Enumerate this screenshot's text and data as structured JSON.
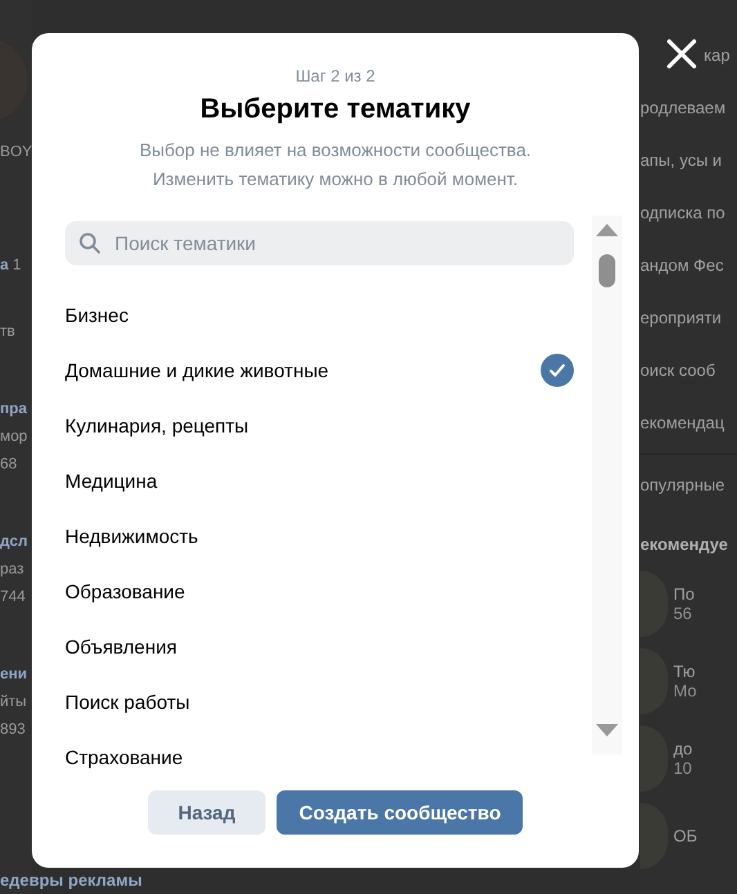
{
  "background": {
    "left_items": [
      {
        "kind": "avatar"
      },
      {
        "kind": "text",
        "text": "BOY"
      },
      {
        "kind": "link",
        "text": "а",
        "count": "1"
      },
      {
        "kind": "text",
        "text": "тв"
      },
      {
        "kind": "heading",
        "text": "пра"
      },
      {
        "kind": "text",
        "text": "мор"
      },
      {
        "kind": "text",
        "text": "68"
      },
      {
        "kind": "heading",
        "text": "дсл"
      },
      {
        "kind": "text",
        "text": "раз"
      },
      {
        "kind": "text",
        "text": "744"
      },
      {
        "kind": "heading",
        "text": "ени"
      },
      {
        "kind": "text",
        "text": "йты"
      },
      {
        "kind": "text",
        "text": "893"
      }
    ],
    "bottom_heading": "едевры рекламы",
    "menu": [
      {
        "kind": "after_close",
        "text": "кар"
      },
      {
        "kind": "item",
        "text": "родлеваем"
      },
      {
        "kind": "item",
        "text": "апы, усы и"
      },
      {
        "kind": "item",
        "text": "одписка по"
      },
      {
        "kind": "item",
        "text": "андом Фес"
      },
      {
        "kind": "item",
        "text": "ероприяти"
      },
      {
        "kind": "item",
        "text": "оиск сооб"
      },
      {
        "kind": "item",
        "text": "екомендац"
      },
      {
        "kind": "divided",
        "text": "опулярные"
      }
    ],
    "recommended_title": "екомендуе",
    "recommended": [
      {
        "name": "По",
        "meta": "56"
      },
      {
        "name": "Тю",
        "meta": "Мо"
      },
      {
        "name": "до",
        "meta": "10"
      },
      {
        "name": "ОБ"
      }
    ]
  },
  "modal": {
    "step": "Шаг 2 из 2",
    "title": "Выберите тематику",
    "subtitle": [
      "Выбор не влияет на возможности сообщества.",
      "Изменить тематику можно в любой момент."
    ],
    "search": {
      "placeholder": "Поиск тематики"
    },
    "topics": [
      {
        "label": "Бизнес",
        "selected": false
      },
      {
        "label": "Домашние и дикие животные",
        "selected": true
      },
      {
        "label": "Кулинария, рецепты",
        "selected": false
      },
      {
        "label": "Медицина",
        "selected": false
      },
      {
        "label": "Недвижимость",
        "selected": false
      },
      {
        "label": "Образование",
        "selected": false
      },
      {
        "label": "Объявления",
        "selected": false
      },
      {
        "label": "Поиск работы",
        "selected": false
      },
      {
        "label": "Страхование",
        "selected": false
      }
    ],
    "buttons": [
      {
        "kind": "secondary",
        "label": "Назад"
      },
      {
        "kind": "primary",
        "label": "Создать сообщество"
      }
    ]
  }
}
